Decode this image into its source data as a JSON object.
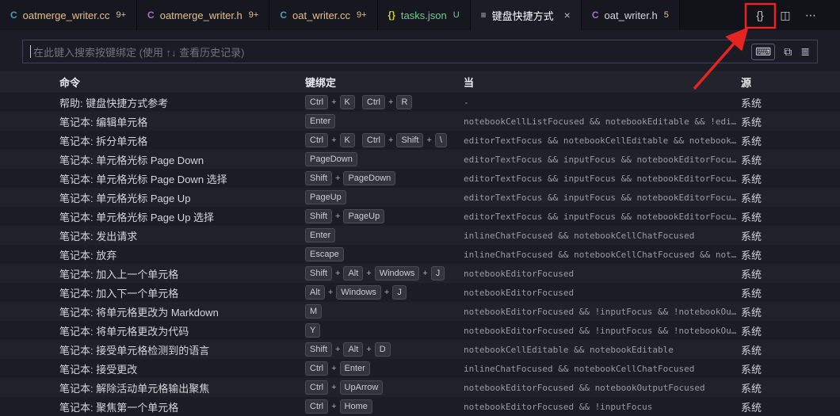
{
  "accent_colors": {
    "git_modified": "#e2c08d",
    "git_untracked": "#73c991",
    "annotation_red": "#e82420"
  },
  "tabs": [
    {
      "id": "oatmerge-writer-cc",
      "label": "oatmerge_writer.cc",
      "badge": "9+",
      "badge_color": "#e2c08d",
      "label_color": "#e2c08d",
      "icon": "cpp-source-icon",
      "icon_glyph": "C",
      "icon_color": "#519aba",
      "active": false
    },
    {
      "id": "oatmerge-writer-h",
      "label": "oatmerge_writer.h",
      "badge": "9+",
      "badge_color": "#e2c08d",
      "label_color": "#e2c08d",
      "icon": "c-header-icon",
      "icon_glyph": "C",
      "icon_color": "#a074c4",
      "active": false
    },
    {
      "id": "oat-writer-cc",
      "label": "oat_writer.cc",
      "badge": "9+",
      "badge_color": "#e2c08d",
      "label_color": "#e2c08d",
      "icon": "cpp-source-icon",
      "icon_glyph": "C",
      "icon_color": "#519aba",
      "active": false
    },
    {
      "id": "tasks-json",
      "label": "tasks.json",
      "badge": "U",
      "badge_color": "#73c991",
      "label_color": "#73c991",
      "icon": "json-file-icon",
      "icon_glyph": "{}",
      "icon_color": "#cbcb41",
      "active": false
    },
    {
      "id": "keyboard-shortcuts",
      "label": "键盘快捷方式",
      "badge": "",
      "badge_color": "",
      "label_color": "#ffffff",
      "icon": "keyboard-shortcuts-icon",
      "icon_glyph": "≡",
      "icon_color": "#c5c5cc",
      "active": true,
      "close_glyph": "×"
    },
    {
      "id": "oat-writer-h",
      "label": "oat_writer.h",
      "badge": "5",
      "badge_color": "#e2c08d",
      "label_color": "#d6d6dc",
      "icon": "c-header-icon",
      "icon_glyph": "C",
      "icon_color": "#a074c4",
      "active": false
    }
  ],
  "editor_actions": [
    {
      "name": "open-keybindings-json-icon",
      "glyph": "{}"
    },
    {
      "name": "split-editor-icon",
      "glyph": "◫"
    },
    {
      "name": "more-actions-icon",
      "glyph": "⋯"
    }
  ],
  "search": {
    "placeholder": "在此键入搜索按键绑定 (使用 ↑↓ 查看历史记录)",
    "icons": [
      {
        "name": "record-keys-icon",
        "glyph": "⌨",
        "boxed": true
      },
      {
        "name": "copy-icon",
        "glyph": "⧉",
        "boxed": false
      },
      {
        "name": "sort-by-precedence-icon",
        "glyph": "≣",
        "boxed": false
      }
    ]
  },
  "table": {
    "headers": {
      "command": "命令",
      "keybinding": "键绑定",
      "when": "当",
      "source": "源"
    },
    "rows": [
      {
        "command": "帮助: 键盘快捷方式参考",
        "chords": [
          [
            "Ctrl",
            "K"
          ],
          [
            "Ctrl",
            "R"
          ]
        ],
        "when": "-",
        "source": "系统"
      },
      {
        "command": "笔记本: 编辑单元格",
        "chords": [
          [
            "Enter"
          ]
        ],
        "when": "notebookCellListFocused && notebookEditable && !edi…",
        "source": "系统"
      },
      {
        "command": "笔记本: 拆分单元格",
        "chords": [
          [
            "Ctrl",
            "K"
          ],
          [
            "Ctrl",
            "Shift",
            "\\"
          ]
        ],
        "when": "editorTextFocus && notebookCellEditable && notebook…",
        "source": "系统"
      },
      {
        "command": "笔记本: 单元格光标 Page Down",
        "chords": [
          [
            "PageDown"
          ]
        ],
        "when": "editorTextFocus && inputFocus && notebookEditorFocu…",
        "source": "系统"
      },
      {
        "command": "笔记本: 单元格光标 Page Down 选择",
        "chords": [
          [
            "Shift",
            "PageDown"
          ]
        ],
        "when": "editorTextFocus && inputFocus && notebookEditorFocu…",
        "source": "系统"
      },
      {
        "command": "笔记本: 单元格光标 Page Up",
        "chords": [
          [
            "PageUp"
          ]
        ],
        "when": "editorTextFocus && inputFocus && notebookEditorFocu…",
        "source": "系统"
      },
      {
        "command": "笔记本: 单元格光标 Page Up 选择",
        "chords": [
          [
            "Shift",
            "PageUp"
          ]
        ],
        "when": "editorTextFocus && inputFocus && notebookEditorFocu…",
        "source": "系统"
      },
      {
        "command": "笔记本: 发出请求",
        "chords": [
          [
            "Enter"
          ]
        ],
        "when": "inlineChatFocused && notebookCellChatFocused",
        "source": "系统"
      },
      {
        "command": "笔记本: 放弃",
        "chords": [
          [
            "Escape"
          ]
        ],
        "when": "inlineChatFocused && notebookCellChatFocused && not…",
        "source": "系统"
      },
      {
        "command": "笔记本: 加入上一个单元格",
        "chords": [
          [
            "Shift",
            "Alt",
            "Windows",
            "J"
          ]
        ],
        "when": "notebookEditorFocused",
        "source": "系统"
      },
      {
        "command": "笔记本: 加入下一个单元格",
        "chords": [
          [
            "Alt",
            "Windows",
            "J"
          ]
        ],
        "when": "notebookEditorFocused",
        "source": "系统"
      },
      {
        "command": "笔记本: 将单元格更改为 Markdown",
        "chords": [
          [
            "M"
          ]
        ],
        "when": "notebookEditorFocused && !inputFocus && !notebookOu…",
        "source": "系统"
      },
      {
        "command": "笔记本: 将单元格更改为代码",
        "chords": [
          [
            "Y"
          ]
        ],
        "when": "notebookEditorFocused && !inputFocus && !notebookOu…",
        "source": "系统"
      },
      {
        "command": "笔记本: 接受单元格检测到的语言",
        "chords": [
          [
            "Shift",
            "Alt",
            "D"
          ]
        ],
        "when": "notebookCellEditable && notebookEditable",
        "source": "系统"
      },
      {
        "command": "笔记本: 接受更改",
        "chords": [
          [
            "Ctrl",
            "Enter"
          ]
        ],
        "when": "inlineChatFocused && notebookCellChatFocused",
        "source": "系统"
      },
      {
        "command": "笔记本: 解除活动单元格输出聚焦",
        "chords": [
          [
            "Ctrl",
            "UpArrow"
          ]
        ],
        "when": "notebookEditorFocused && notebookOutputFocused",
        "source": "系统"
      },
      {
        "command": "笔记本: 聚焦第一个单元格",
        "chords": [
          [
            "Ctrl",
            "Home"
          ]
        ],
        "when": "notebookEditorFocused && !inputFocus",
        "source": "系统"
      }
    ]
  }
}
